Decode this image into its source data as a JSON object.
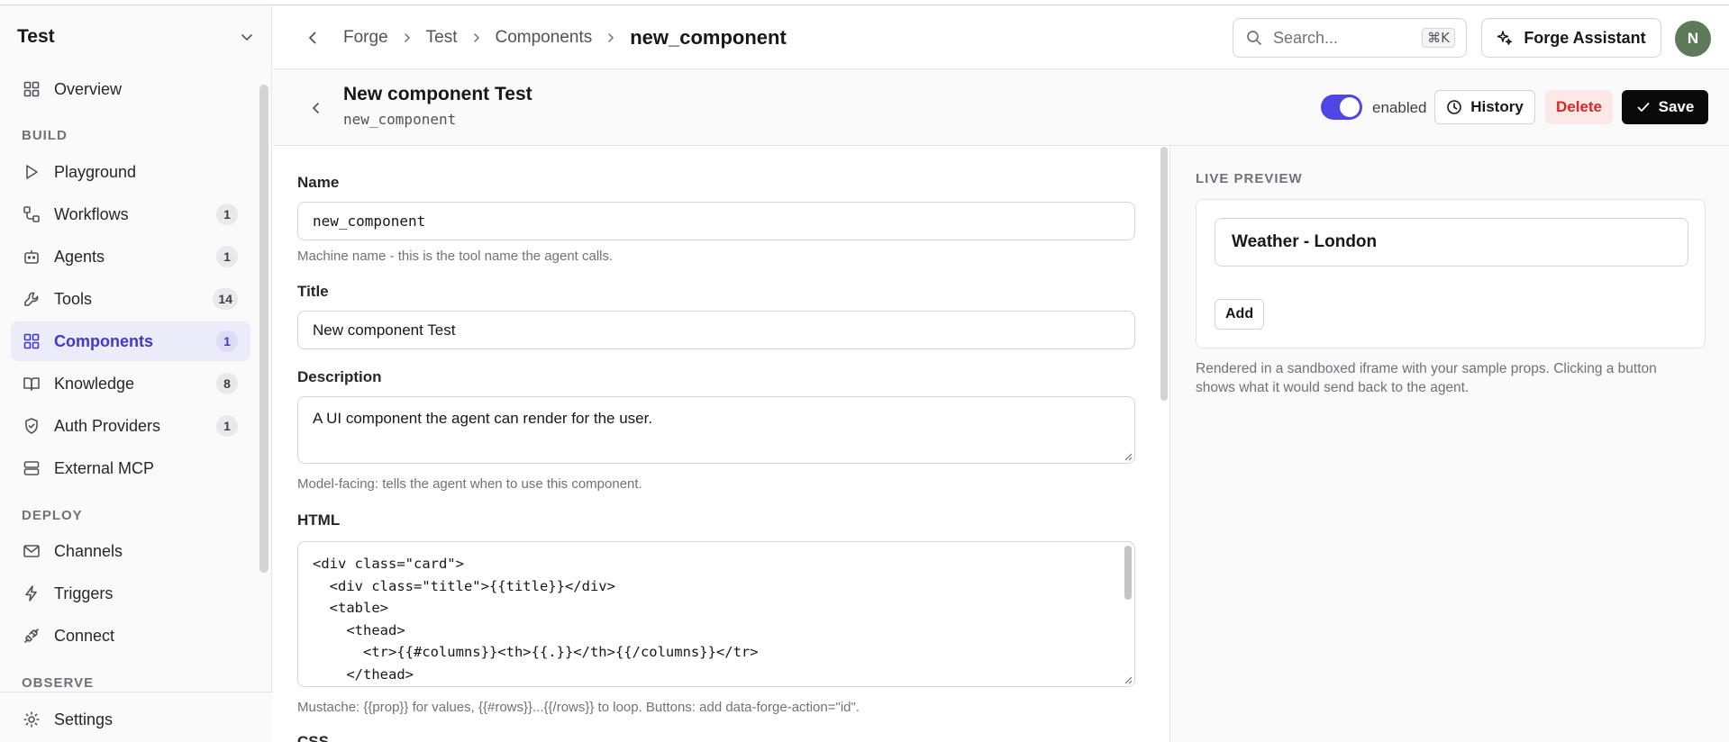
{
  "sidebar": {
    "workspace": "Test",
    "overview": "Overview",
    "sections": {
      "build": "BUILD",
      "deploy": "DEPLOY",
      "observe": "OBSERVE"
    },
    "build_items": [
      {
        "label": "Playground",
        "count": ""
      },
      {
        "label": "Workflows",
        "count": "1"
      },
      {
        "label": "Agents",
        "count": "1"
      },
      {
        "label": "Tools",
        "count": "14"
      },
      {
        "label": "Components",
        "count": "1"
      },
      {
        "label": "Knowledge",
        "count": "8"
      },
      {
        "label": "Auth Providers",
        "count": "1"
      },
      {
        "label": "External MCP",
        "count": ""
      }
    ],
    "deploy_items": [
      {
        "label": "Channels"
      },
      {
        "label": "Triggers"
      },
      {
        "label": "Connect"
      }
    ],
    "settings": "Settings",
    "accent": "#4338ca"
  },
  "header": {
    "breadcrumbs": [
      "Forge",
      "Test",
      "Components"
    ],
    "current": "new_component",
    "search_placeholder": "Search...",
    "search_shortcut": "⌘K",
    "assistant_label": "Forge Assistant",
    "avatar_initial": "N"
  },
  "component": {
    "title": "New component Test",
    "machine_name": "new_component",
    "enabled_label": "enabled",
    "enabled": true,
    "history_label": "History",
    "delete_label": "Delete",
    "save_label": "Save"
  },
  "form": {
    "name_label": "Name",
    "name_value": "new_component",
    "name_help": "Machine name - this is the tool name the agent calls.",
    "title_label": "Title",
    "title_value": "New component Test",
    "description_label": "Description",
    "description_value": "A UI component the agent can render for the user.",
    "description_help": "Model-facing: tells the agent when to use this component.",
    "html_label": "HTML",
    "html_lines": [
      "<div class=\"card\">",
      "  <div class=\"title\">{{title}}</div>",
      "  <table>",
      "    <thead>",
      "      <tr>{{#columns}}<th>{{.}}</th>{{/columns}}</tr>",
      "    </thead>"
    ],
    "html_help": "Mustache: {{prop}} for values, {{#rows}}...{{/rows}} to loop. Buttons: add data-forge-action=\"id\".",
    "next_label": "CSS"
  },
  "preview": {
    "heading": "LIVE PREVIEW",
    "card_title": "Weather - London",
    "add_label": "Add",
    "note": "Rendered in a sandboxed iframe with your sample props. Clicking a button shows what it would send back to the agent."
  }
}
